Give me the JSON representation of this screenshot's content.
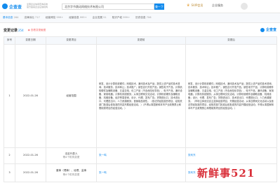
{
  "header": {
    "logo_text": "企查查",
    "logo_sub": "全国企业信用查询系统\n官方备案企业征信机构",
    "search_value": "北京字节跳动网络技术有限公司",
    "search_button": "查一下",
    "vip": "SVIP会员",
    "nav_service": "企业服务"
  },
  "tabs": [
    {
      "label": "基本信息",
      "count": "264",
      "active": true
    },
    {
      "label": "法律诉讼",
      "count": "717"
    },
    {
      "label": "经营风险",
      "count": "999+"
    },
    {
      "label": "经营信息",
      "count": "999+"
    },
    {
      "label": "企业发展",
      "count": "51"
    },
    {
      "label": "知识产权",
      "count": "999+"
    },
    {
      "label": "历史信息",
      "count": "706"
    }
  ],
  "section": {
    "title": "变更记录",
    "count": "254",
    "link": "查看变更截图",
    "right": "企查查"
  },
  "table": {
    "headers": [
      "序号",
      "变更日期",
      "变更项目",
      "变更前",
      "变更后"
    ],
    "rows": [
      {
        "index": "1",
        "date": "2022-01-26",
        "item": "经营范围",
        "before": "研发、设计计算机软硬件；网络技术、通讯技术及产品；提供上述产品的技术咨询、技术服务、技术转让；技术推广；销售自行开发产品；销售电子产品、计算机软硬件及辅助设备、五金交电、化工产品（不含危险化学品）、电子产品、通讯设备、家用电器；计算机系统服务；从事互联网文化活动；计算机软硬件及辅助设备、机械设备、经济贸易咨询、设计、代理、发布广告；货物进出口、技术进出口、代理进出口；人力资源服务；音像制品零售。（依法须经批准的项目，经相关部门批准后依批准的内容开展经营活动。）（不得从事国家和本市产业政策禁止和限制类项目的经营活动。）",
        "after": "研发、设计计算机软硬件；网络技术、通讯技术及产品；提供上述产品的技术咨询、技术服务、技术转让；技术推广；销售自行开发产品；销售电子产品、计算机软硬件及辅助设备、五金交电、化工产品（不含危险化学品）、电子产品、通讯设备、家用电器；计算机系统服务；从事互联网文化活动；计算机软硬件及辅助设备、机械设备；设计、代理、发布广告；货物进出口、技术进出口、代理进出口；人力资源服务。（市场主体依法自主选择经营项目，开展经营活动；从事互联网文化活动以及依法须经批准的项目，经相关部门批准后依批准的内容开展经营活动；不得从事国家和本市产业政策禁止和限制类项目的经营活动。）"
      },
      {
        "index": "2",
        "date": "2022-01-26",
        "item": "法定代表人",
        "item_note": "等4个机构变更",
        "before": "张一鸣",
        "after": "张利东"
      },
      {
        "index": "3",
        "date": "2022-01-26",
        "item": "董事（理事）、经理、监事",
        "item_note": "等4个机构变更",
        "before": "张一鸣",
        "after": "张利东"
      }
    ]
  },
  "watermark": "新鲜事521"
}
